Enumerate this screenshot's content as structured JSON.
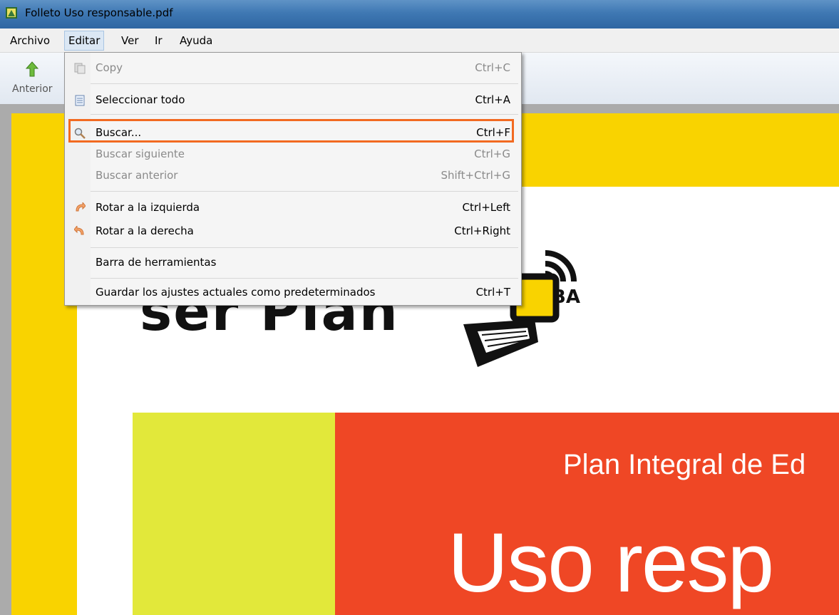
{
  "window": {
    "title": "Folleto Uso responsable.pdf"
  },
  "menubar": [
    "Archivo",
    "Editar",
    "Ver",
    "Ir",
    "Ayuda"
  ],
  "toolbar": {
    "prev_label": "Anterior"
  },
  "edit_menu": {
    "items": [
      {
        "label": "Copy",
        "shortcut": "Ctrl+C",
        "enabled": false,
        "icon": "copy-icon"
      },
      {
        "label": "Seleccionar todo",
        "shortcut": "Ctrl+A",
        "enabled": true,
        "icon": "select-all-icon"
      },
      {
        "label": "Buscar...",
        "shortcut": "Ctrl+F",
        "enabled": true,
        "icon": "search-icon",
        "highlighted": true
      },
      {
        "label": "Buscar siguiente",
        "shortcut": "Ctrl+G",
        "enabled": false
      },
      {
        "label": "Buscar anterior",
        "shortcut": "Shift+Ctrl+G",
        "enabled": false
      },
      {
        "label": "Rotar a la izquierda",
        "shortcut": "Ctrl+Left",
        "enabled": true,
        "icon": "rotate-left-icon"
      },
      {
        "label": "Rotar a la derecha",
        "shortcut": "Ctrl+Right",
        "enabled": true,
        "icon": "rotate-right-icon"
      },
      {
        "label": "Barra de herramientas",
        "shortcut": "",
        "enabled": true
      },
      {
        "label": "Guardar los ajustes actuales como predeterminados",
        "shortcut": "Ctrl+T",
        "enabled": true
      }
    ]
  },
  "document": {
    "logo_ba": "BA",
    "plan_text": "Plan Integral de Ed",
    "title_text": "Uso resp"
  },
  "colors": {
    "highlight": "#f26a21",
    "page_yellow": "#f9d300",
    "orange": "#ef4725",
    "lime": "#e2e83a"
  }
}
